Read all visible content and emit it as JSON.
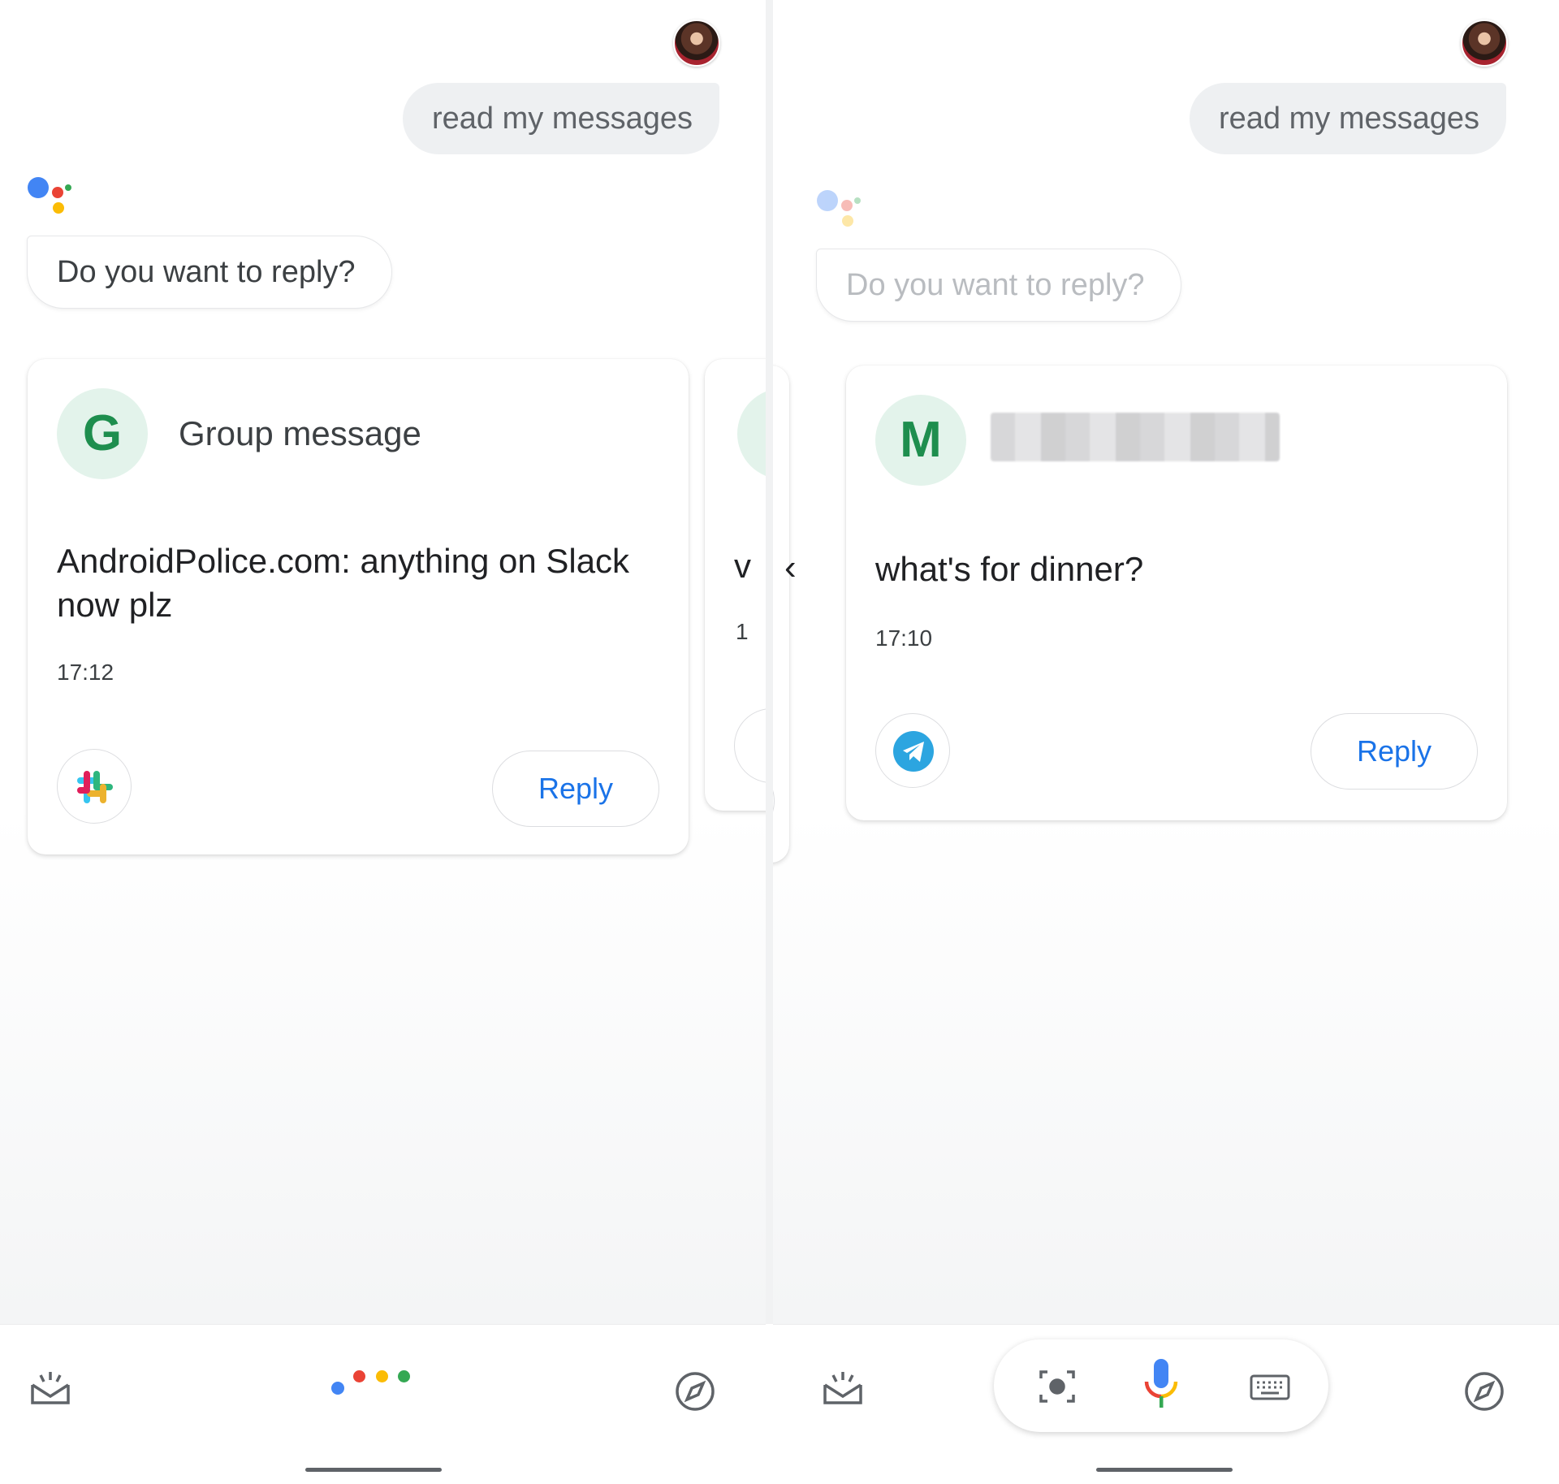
{
  "left": {
    "user_query": "read my messages",
    "assistant_prompt": "Do you want to reply?",
    "card": {
      "avatar_letter": "G",
      "sender": "Group message",
      "message": "AndroidPolice.com: anything on Slack now plz",
      "time": "17:12",
      "app_icon": "slack-icon",
      "reply_label": "Reply"
    },
    "peek_card": {
      "message_fragment": "v",
      "time_fragment": "1"
    }
  },
  "right": {
    "user_query": "read my messages",
    "assistant_prompt": "Do you want to reply?",
    "prev_chevron": "‹",
    "card": {
      "avatar_letter": "M",
      "message": "what's for dinner?",
      "time": "17:10",
      "app_icon": "telegram-icon",
      "reply_label": "Reply"
    }
  },
  "colors": {
    "google_blue": "#4285f4",
    "google_red": "#ea4335",
    "google_yellow": "#fbbc05",
    "google_green": "#34a853",
    "reply_text": "#1a73e8"
  }
}
